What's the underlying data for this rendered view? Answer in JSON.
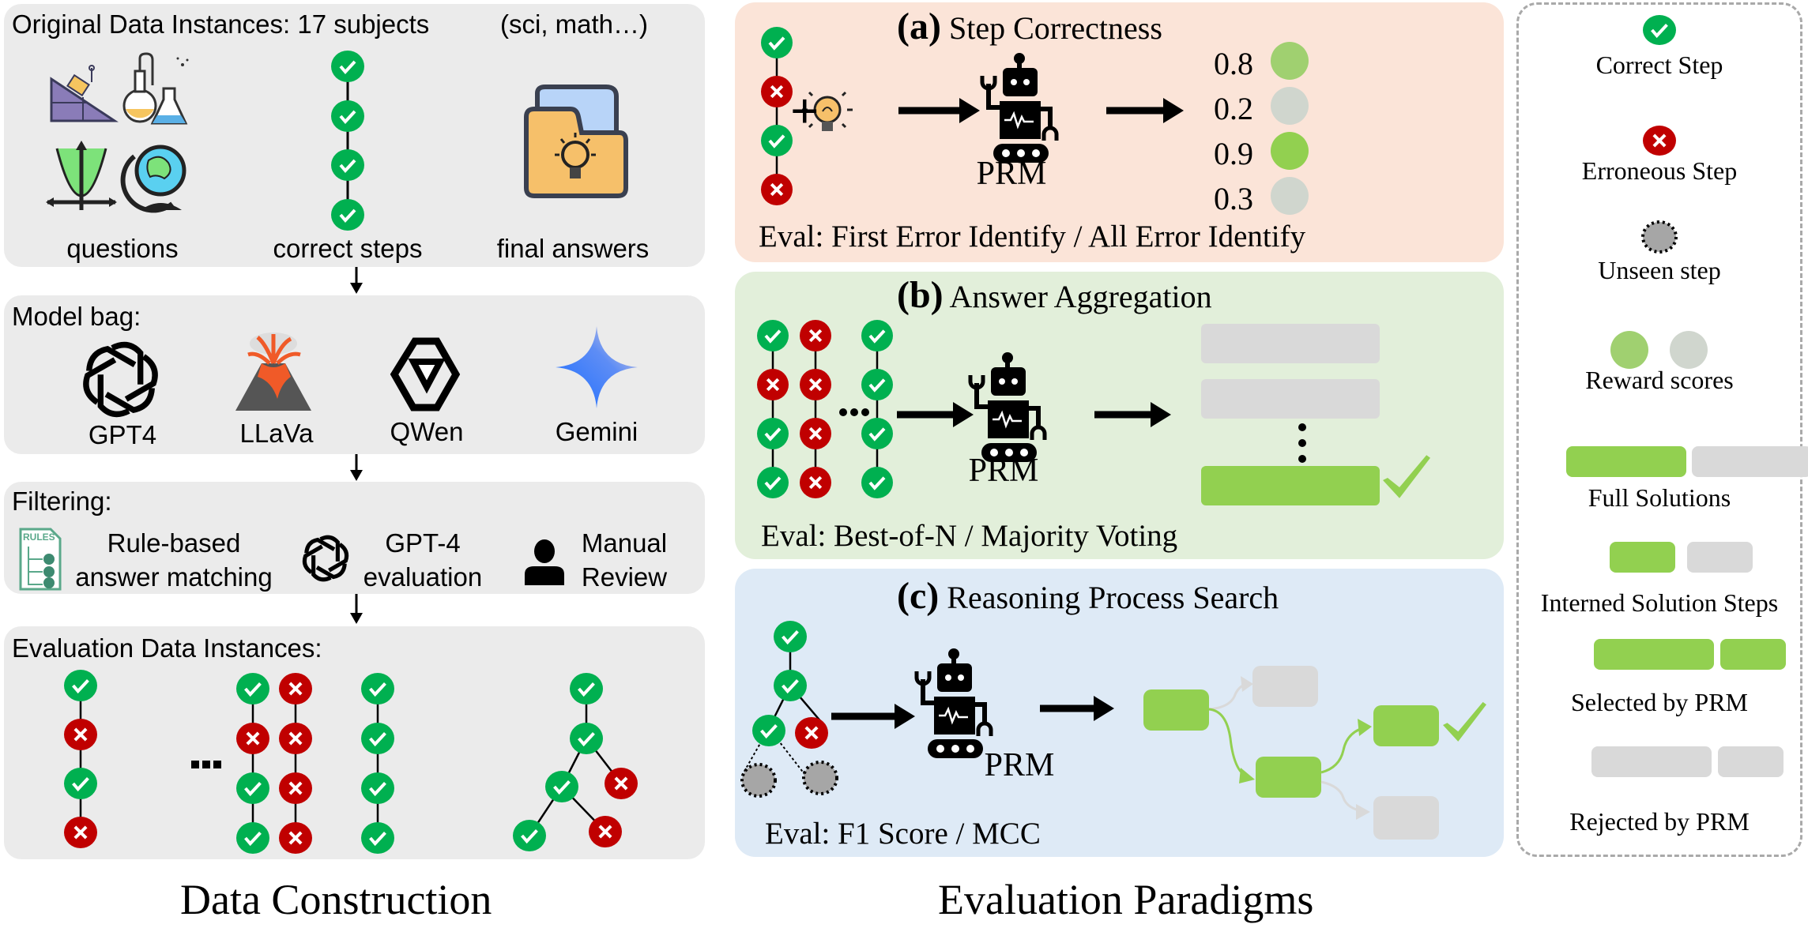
{
  "colors": {
    "correct": "#00b050",
    "error": "#c00000",
    "unseen": "#a6a6a6",
    "reward_high": "#a0d070",
    "reward_low": "#d0d6ce",
    "selected": "#92d050",
    "rejected": "#d9d9d9",
    "panel_gray": "#ebebeb",
    "panel_a": "#fbe4d8",
    "panel_b": "#e2efda",
    "panel_c": "#deeaf6"
  },
  "data_construction": {
    "caption": "Data Construction",
    "original": {
      "title": "Original Data Instances:  17 subjects",
      "subtitle": "(sci, math…)",
      "labels": [
        "questions",
        "correct steps",
        "final answers"
      ],
      "step_chain": [
        "correct",
        "correct",
        "correct",
        "correct"
      ]
    },
    "model_bag": {
      "title": "Model bag:",
      "models": [
        "GPT4",
        "LLaVa",
        "QWen",
        "Gemini"
      ]
    },
    "filtering": {
      "title": "Filtering:",
      "methods": [
        {
          "line1": "Rule-based",
          "line2": "answer matching",
          "icon": "rules-checklist-icon"
        },
        {
          "line1": "GPT-4",
          "line2": "evaluation",
          "icon": "openai-logo-icon"
        },
        {
          "line1": "Manual",
          "line2": "Review",
          "icon": "person-icon"
        }
      ],
      "rules_icon_text": "RULES"
    },
    "evaluation_instances": {
      "title": "Evaluation Data Instances:",
      "single_chain": [
        "correct",
        "error",
        "correct",
        "error"
      ],
      "multi_chains": [
        [
          "correct",
          "error",
          "correct",
          "correct"
        ],
        [
          "error",
          "error",
          "error",
          "error"
        ],
        [
          "correct",
          "correct",
          "correct",
          "correct"
        ]
      ],
      "ellipsis": "···"
    }
  },
  "evaluation_paradigms": {
    "caption": "Evaluation Paradigms",
    "step_correctness": {
      "letter": "(a)",
      "title": "Step Correctness",
      "chain": [
        "correct",
        "error",
        "correct",
        "error"
      ],
      "plus": "+",
      "model_label": "PRM",
      "scores": [
        {
          "value": "0.8",
          "level": "high"
        },
        {
          "value": "0.2",
          "level": "low"
        },
        {
          "value": "0.9",
          "level": "high"
        },
        {
          "value": "0.3",
          "level": "low"
        }
      ],
      "eval": "Eval: First Error Identify / All Error Identify"
    },
    "answer_aggregation": {
      "letter": "(b)",
      "title": "Answer Aggregation",
      "chains": [
        [
          "correct",
          "error",
          "correct",
          "correct"
        ],
        [
          "error",
          "error",
          "error",
          "error"
        ],
        [
          "correct",
          "correct",
          "correct",
          "correct"
        ]
      ],
      "model_label": "PRM",
      "solutions": [
        "rejected",
        "rejected",
        "selected"
      ],
      "eval": "Eval: Best-of-N  / Majority Voting"
    },
    "process_search": {
      "letter": "(c)",
      "title": "Reasoning Process Search",
      "model_label": "PRM",
      "eval": "Eval: F1 Score / MCC"
    }
  },
  "legend": {
    "items": [
      {
        "label": "Correct Step",
        "icon": "correct-step-icon"
      },
      {
        "label": "Erroneous Step",
        "icon": "erroneous-step-icon"
      },
      {
        "label": "Unseen step",
        "icon": "unseen-step-icon"
      },
      {
        "label": "Reward scores",
        "icon": "reward-score-dots"
      },
      {
        "label": "Full Solutions",
        "icon": "full-solution-bars"
      },
      {
        "label": "Interned Solution Steps",
        "icon": "interned-step-bars"
      },
      {
        "label": "Selected by PRM",
        "icon": "selected-bars"
      },
      {
        "label": "Rejected by PRM",
        "icon": "rejected-bars"
      }
    ]
  }
}
